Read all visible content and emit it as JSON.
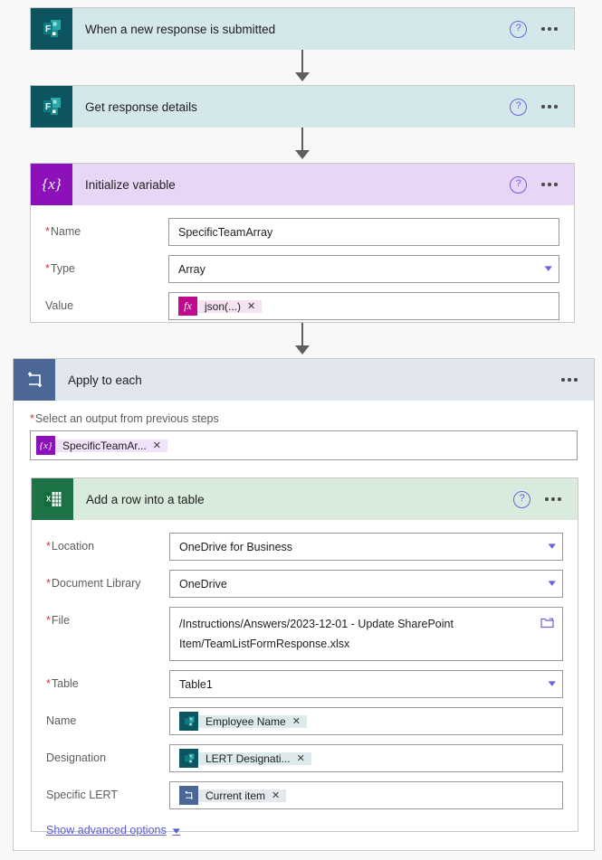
{
  "flow": {
    "steps": [
      {
        "id": "trigger",
        "title": "When a new response is submitted",
        "icon": "microsoft-forms-icon",
        "help_label": "?",
        "menu_label": "More commands"
      },
      {
        "id": "get-response",
        "title": "Get response details",
        "icon": "microsoft-forms-icon",
        "help_label": "?",
        "menu_label": "More commands"
      },
      {
        "id": "init-variable",
        "title": "Initialize variable",
        "icon": "variable-icon",
        "icon_glyph": "{x}",
        "help_label": "?",
        "menu_label": "More commands",
        "fields": [
          {
            "label": "Name",
            "required": true,
            "value": "SpecificTeamArray",
            "control": "text"
          },
          {
            "label": "Type",
            "required": true,
            "value": "Array",
            "control": "dropdown"
          },
          {
            "label": "Value",
            "required": false,
            "control": "token",
            "token": {
              "kind": "fx",
              "icon_glyph": "fx",
              "text": "json(...)",
              "remove": "✕"
            }
          }
        ]
      }
    ],
    "loop": {
      "id": "apply-to-each",
      "title": "Apply to each",
      "icon": "loop-icon",
      "menu_label": "More commands",
      "select_label": "Select an output from previous steps",
      "select_required": true,
      "select_token": {
        "kind": "variable",
        "icon_glyph": "{x}",
        "text": "SpecificTeamAr...",
        "remove": "✕"
      },
      "action": {
        "id": "add-row-into-table",
        "title": "Add a row into a table",
        "icon": "excel-icon",
        "icon_glyph": "X",
        "help_label": "?",
        "menu_label": "More commands",
        "fields": [
          {
            "label": "Location",
            "required": true,
            "value": "OneDrive for Business",
            "control": "dropdown"
          },
          {
            "label": "Document Library",
            "required": true,
            "value": "OneDrive",
            "control": "dropdown"
          },
          {
            "label": "File",
            "required": true,
            "control": "path",
            "value": "/Instructions/Answers/2023-12-01 - Update SharePoint Item/TeamListFormResponse.xlsx",
            "picker_icon": "folder-icon"
          },
          {
            "label": "Table",
            "required": true,
            "value": "Table1",
            "control": "dropdown"
          },
          {
            "label": "Name",
            "required": false,
            "control": "token",
            "token": {
              "kind": "forms",
              "text": "Employee Name",
              "remove": "✕"
            }
          },
          {
            "label": "Designation",
            "required": false,
            "control": "token",
            "token": {
              "kind": "forms",
              "text": "LERT Designati...",
              "remove": "✕"
            }
          },
          {
            "label": "Specific LERT",
            "required": false,
            "control": "token",
            "token": {
              "kind": "loop",
              "text": "Current item",
              "remove": "✕"
            }
          }
        ],
        "advanced_options_label": "Show advanced options"
      }
    }
  },
  "colors": {
    "forms_brand": "#0c5460",
    "variable_brand": "#8c11b8",
    "excel_brand": "#1b7346",
    "loop_brand": "#4a6795",
    "accent_link": "#5b5bd6",
    "required_asterisk": "#d13438"
  }
}
